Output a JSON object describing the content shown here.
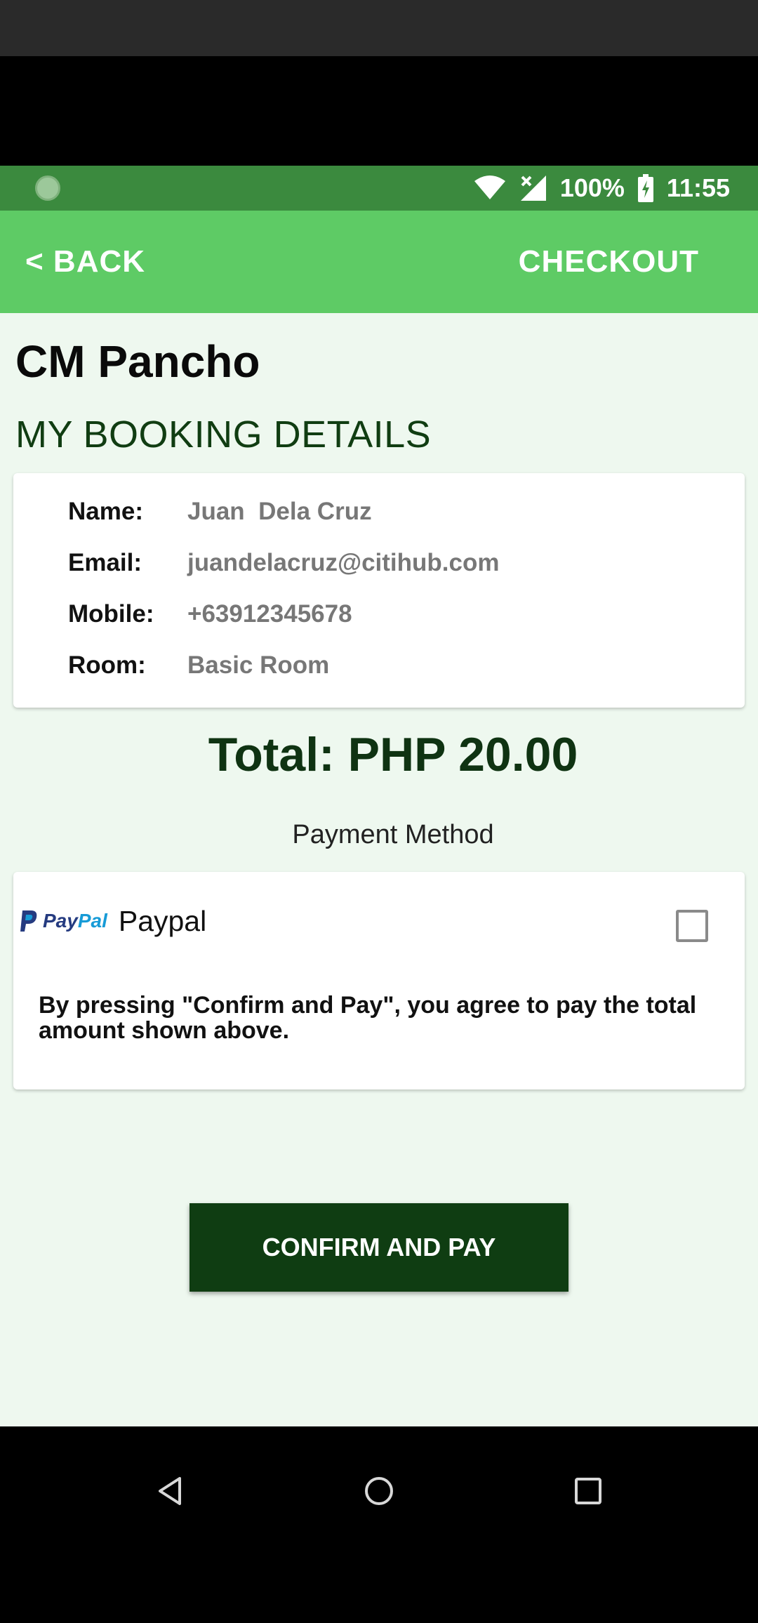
{
  "status_bar": {
    "battery": "100%",
    "time": "11:55"
  },
  "app_bar": {
    "back_label": "< BACK",
    "title": "CHECKOUT"
  },
  "hotel": {
    "name": "CM Pancho"
  },
  "booking": {
    "section_title": "MY BOOKING DETAILS",
    "rows": [
      {
        "label": "Name:",
        "value": "Juan  Dela Cruz"
      },
      {
        "label": "Email:",
        "value": "juandelacruz@citihub.com"
      },
      {
        "label": "Mobile:",
        "value": "+63912345678"
      },
      {
        "label": "Room:",
        "value": "Basic Room"
      }
    ]
  },
  "total": {
    "text": "Total: PHP 20.00"
  },
  "payment": {
    "section_label": "Payment Method",
    "logo_text_pay": "Pay",
    "logo_text_pal": "Pal",
    "method_label": "Paypal",
    "checked": false,
    "agreement": "By pressing \"Confirm and Pay\", you agree to pay the total amount shown above."
  },
  "confirm_button": {
    "label": "CONFIRM AND PAY"
  },
  "colors": {
    "app_bar": "#5ecb65",
    "status_bar": "#3b8a3e",
    "background": "#eef8ef",
    "primary_dark": "#0f3d12"
  }
}
